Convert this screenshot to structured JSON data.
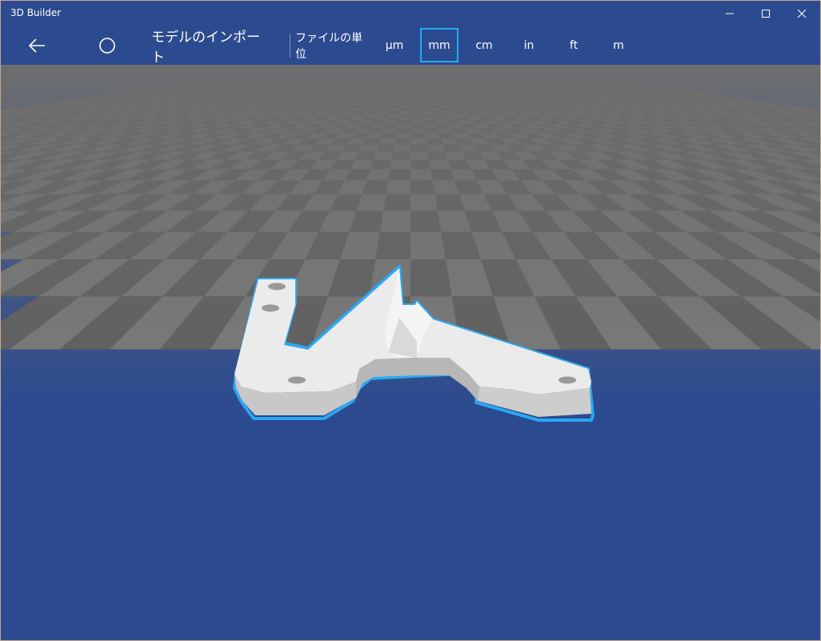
{
  "app": {
    "title": "3D Builder"
  },
  "toolbar": {
    "import_label": "モデルのインポート",
    "units_label": "ファイルの単位",
    "units": [
      {
        "label": "μm",
        "selected": false
      },
      {
        "label": "mm",
        "selected": true
      },
      {
        "label": "cm",
        "selected": false
      },
      {
        "label": "in",
        "selected": false
      },
      {
        "label": "ft",
        "selected": false
      },
      {
        "label": "m",
        "selected": false
      }
    ]
  },
  "colors": {
    "toolbar_bg": "#2c4a8f",
    "accent": "#29a8f2",
    "grid_light": "#7a7a7a",
    "grid_dark": "#5e5e5e",
    "model": "#e6e6e6"
  },
  "icons": {
    "back": "arrow-left-icon",
    "circle": "circle-icon",
    "minimize": "minimize-icon",
    "maximize": "maximize-icon",
    "close": "close-icon"
  }
}
